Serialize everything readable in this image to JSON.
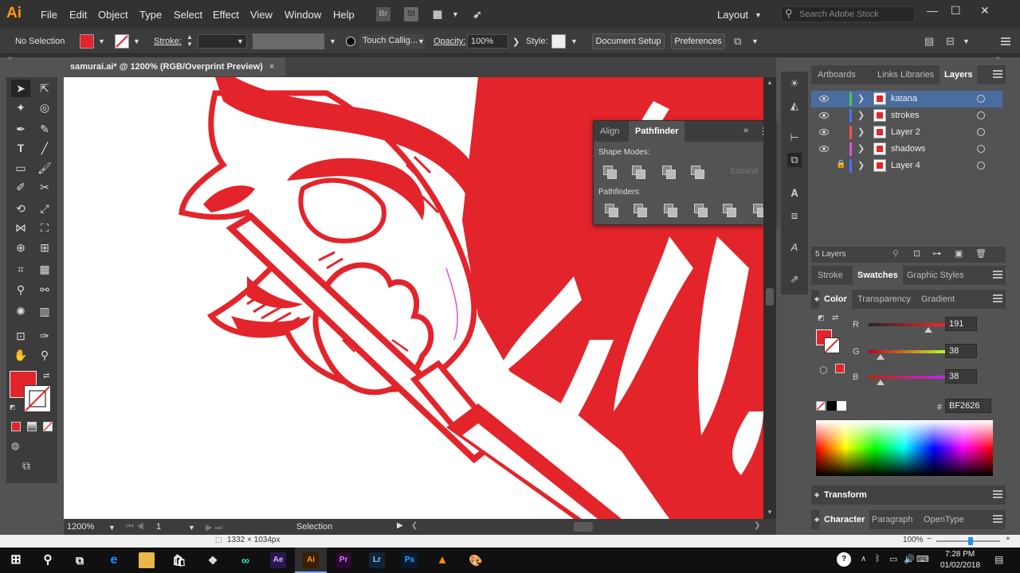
{
  "app": {
    "logo": "Ai",
    "menu": [
      "File",
      "Edit",
      "Object",
      "Type",
      "Select",
      "Effect",
      "View",
      "Window",
      "Help"
    ],
    "bridge_icon": "Br",
    "stock_icon": "St",
    "workspace": "Layout",
    "search_placeholder": "Search Adobe Stock"
  },
  "control_bar": {
    "selection": "No Selection",
    "fill_color": "#e3242b",
    "stroke_label": "Stroke:",
    "brush": "Touch Callig...",
    "opacity_label": "Opacity:",
    "opacity": "100%",
    "style_label": "Style:",
    "document_setup": "Document Setup",
    "preferences": "Preferences"
  },
  "document": {
    "tab_title": "samurai.ai* @ 1200% (RGB/Overprint Preview)",
    "close": "×",
    "accent": "#e3242b"
  },
  "status_bar": {
    "zoom": "1200%",
    "artboard": "1",
    "tool": "Selection"
  },
  "info_bar": {
    "dimensions": "1332 × 1034px",
    "zoom": "100%"
  },
  "pathfinder": {
    "tabs": [
      "Align",
      "Pathfinder"
    ],
    "active_tab": "Pathfinder",
    "shape_modes_label": "Shape Modes:",
    "expand": "Expand",
    "pathfinders_label": "Pathfinders:"
  },
  "layers_panel": {
    "tabs": [
      "Artboards",
      "Links",
      "Libraries",
      "Layers"
    ],
    "active_tab": "Layers",
    "layers": [
      {
        "name": "katana",
        "color": "#4fc44f",
        "visible": true,
        "locked": false,
        "selected": true
      },
      {
        "name": "strokes",
        "color": "#4f6cff",
        "visible": true,
        "locked": false,
        "selected": false
      },
      {
        "name": "Layer 2",
        "color": "#ff4f4f",
        "visible": true,
        "locked": false,
        "selected": false
      },
      {
        "name": "shadows",
        "color": "#e04fe0",
        "visible": true,
        "locked": false,
        "selected": false
      },
      {
        "name": "Layer 4",
        "color": "#4f6cff",
        "visible": false,
        "locked": true,
        "selected": false
      }
    ],
    "count": "5 Layers"
  },
  "swatches_panel": {
    "tabs": [
      "Stroke",
      "Swatches",
      "Graphic Styles"
    ],
    "active_tab": "Swatches"
  },
  "color_panel": {
    "tabs": [
      "Color",
      "Transparency",
      "Gradient"
    ],
    "active_tab": "Color",
    "channels": [
      {
        "label": "R",
        "value": "191",
        "level": 0.749
      },
      {
        "label": "G",
        "value": "38",
        "level": 0.149
      },
      {
        "label": "B",
        "value": "38",
        "level": 0.149
      }
    ],
    "hex_label": "#",
    "hex": "BF2626"
  },
  "collapsed_panels": {
    "transform": "Transform",
    "character_tabs": [
      "Character",
      "Paragraph",
      "OpenType"
    ]
  },
  "taskbar": {
    "apps": [
      "Ae",
      "Ai",
      "Pr",
      "Lr",
      "Ps"
    ],
    "time": "7:28 PM",
    "date": "01/02/2018"
  }
}
